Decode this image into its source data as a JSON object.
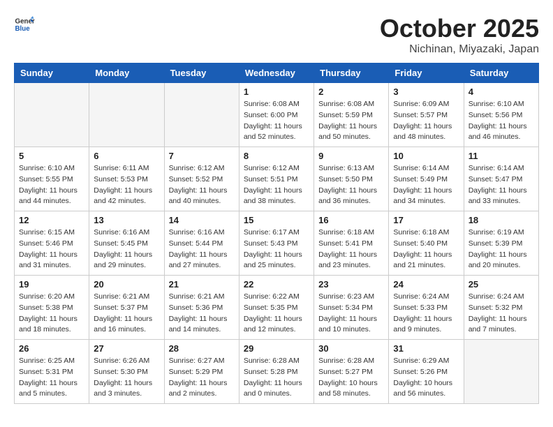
{
  "header": {
    "logo_general": "General",
    "logo_blue": "Blue",
    "month": "October 2025",
    "location": "Nichinan, Miyazaki, Japan"
  },
  "days_of_week": [
    "Sunday",
    "Monday",
    "Tuesday",
    "Wednesday",
    "Thursday",
    "Friday",
    "Saturday"
  ],
  "weeks": [
    [
      {
        "day": "",
        "info": ""
      },
      {
        "day": "",
        "info": ""
      },
      {
        "day": "",
        "info": ""
      },
      {
        "day": "1",
        "info": "Sunrise: 6:08 AM\nSunset: 6:00 PM\nDaylight: 11 hours and 52 minutes."
      },
      {
        "day": "2",
        "info": "Sunrise: 6:08 AM\nSunset: 5:59 PM\nDaylight: 11 hours and 50 minutes."
      },
      {
        "day": "3",
        "info": "Sunrise: 6:09 AM\nSunset: 5:57 PM\nDaylight: 11 hours and 48 minutes."
      },
      {
        "day": "4",
        "info": "Sunrise: 6:10 AM\nSunset: 5:56 PM\nDaylight: 11 hours and 46 minutes."
      }
    ],
    [
      {
        "day": "5",
        "info": "Sunrise: 6:10 AM\nSunset: 5:55 PM\nDaylight: 11 hours and 44 minutes."
      },
      {
        "day": "6",
        "info": "Sunrise: 6:11 AM\nSunset: 5:53 PM\nDaylight: 11 hours and 42 minutes."
      },
      {
        "day": "7",
        "info": "Sunrise: 6:12 AM\nSunset: 5:52 PM\nDaylight: 11 hours and 40 minutes."
      },
      {
        "day": "8",
        "info": "Sunrise: 6:12 AM\nSunset: 5:51 PM\nDaylight: 11 hours and 38 minutes."
      },
      {
        "day": "9",
        "info": "Sunrise: 6:13 AM\nSunset: 5:50 PM\nDaylight: 11 hours and 36 minutes."
      },
      {
        "day": "10",
        "info": "Sunrise: 6:14 AM\nSunset: 5:49 PM\nDaylight: 11 hours and 34 minutes."
      },
      {
        "day": "11",
        "info": "Sunrise: 6:14 AM\nSunset: 5:47 PM\nDaylight: 11 hours and 33 minutes."
      }
    ],
    [
      {
        "day": "12",
        "info": "Sunrise: 6:15 AM\nSunset: 5:46 PM\nDaylight: 11 hours and 31 minutes."
      },
      {
        "day": "13",
        "info": "Sunrise: 6:16 AM\nSunset: 5:45 PM\nDaylight: 11 hours and 29 minutes."
      },
      {
        "day": "14",
        "info": "Sunrise: 6:16 AM\nSunset: 5:44 PM\nDaylight: 11 hours and 27 minutes."
      },
      {
        "day": "15",
        "info": "Sunrise: 6:17 AM\nSunset: 5:43 PM\nDaylight: 11 hours and 25 minutes."
      },
      {
        "day": "16",
        "info": "Sunrise: 6:18 AM\nSunset: 5:41 PM\nDaylight: 11 hours and 23 minutes."
      },
      {
        "day": "17",
        "info": "Sunrise: 6:18 AM\nSunset: 5:40 PM\nDaylight: 11 hours and 21 minutes."
      },
      {
        "day": "18",
        "info": "Sunrise: 6:19 AM\nSunset: 5:39 PM\nDaylight: 11 hours and 20 minutes."
      }
    ],
    [
      {
        "day": "19",
        "info": "Sunrise: 6:20 AM\nSunset: 5:38 PM\nDaylight: 11 hours and 18 minutes."
      },
      {
        "day": "20",
        "info": "Sunrise: 6:21 AM\nSunset: 5:37 PM\nDaylight: 11 hours and 16 minutes."
      },
      {
        "day": "21",
        "info": "Sunrise: 6:21 AM\nSunset: 5:36 PM\nDaylight: 11 hours and 14 minutes."
      },
      {
        "day": "22",
        "info": "Sunrise: 6:22 AM\nSunset: 5:35 PM\nDaylight: 11 hours and 12 minutes."
      },
      {
        "day": "23",
        "info": "Sunrise: 6:23 AM\nSunset: 5:34 PM\nDaylight: 11 hours and 10 minutes."
      },
      {
        "day": "24",
        "info": "Sunrise: 6:24 AM\nSunset: 5:33 PM\nDaylight: 11 hours and 9 minutes."
      },
      {
        "day": "25",
        "info": "Sunrise: 6:24 AM\nSunset: 5:32 PM\nDaylight: 11 hours and 7 minutes."
      }
    ],
    [
      {
        "day": "26",
        "info": "Sunrise: 6:25 AM\nSunset: 5:31 PM\nDaylight: 11 hours and 5 minutes."
      },
      {
        "day": "27",
        "info": "Sunrise: 6:26 AM\nSunset: 5:30 PM\nDaylight: 11 hours and 3 minutes."
      },
      {
        "day": "28",
        "info": "Sunrise: 6:27 AM\nSunset: 5:29 PM\nDaylight: 11 hours and 2 minutes."
      },
      {
        "day": "29",
        "info": "Sunrise: 6:28 AM\nSunset: 5:28 PM\nDaylight: 11 hours and 0 minutes."
      },
      {
        "day": "30",
        "info": "Sunrise: 6:28 AM\nSunset: 5:27 PM\nDaylight: 10 hours and 58 minutes."
      },
      {
        "day": "31",
        "info": "Sunrise: 6:29 AM\nSunset: 5:26 PM\nDaylight: 10 hours and 56 minutes."
      },
      {
        "day": "",
        "info": ""
      }
    ]
  ]
}
